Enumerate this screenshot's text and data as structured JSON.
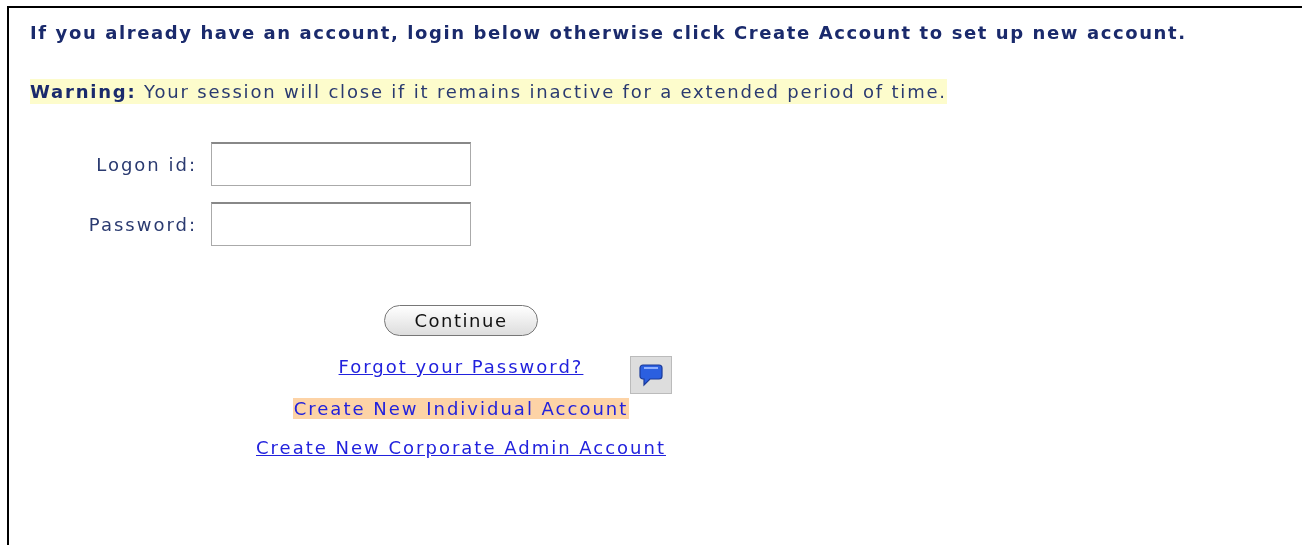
{
  "intro": "If you already have an account, login below otherwise click Create Account to set up new account.",
  "warning": {
    "label": "Warning:",
    "text": "Your session will close if it remains inactive for a extended period of time."
  },
  "fields": [
    {
      "label": "Logon id:"
    },
    {
      "label": "Password:"
    }
  ],
  "continue_button": "Continue",
  "links": [
    {
      "text": "Forgot your Password?",
      "highlighted": false,
      "help_icon": true
    },
    {
      "text": "Create New Individual Account",
      "highlighted": true,
      "help_icon": false
    },
    {
      "text": "Create New Corporate Admin Account",
      "highlighted": false,
      "help_icon": false
    }
  ]
}
